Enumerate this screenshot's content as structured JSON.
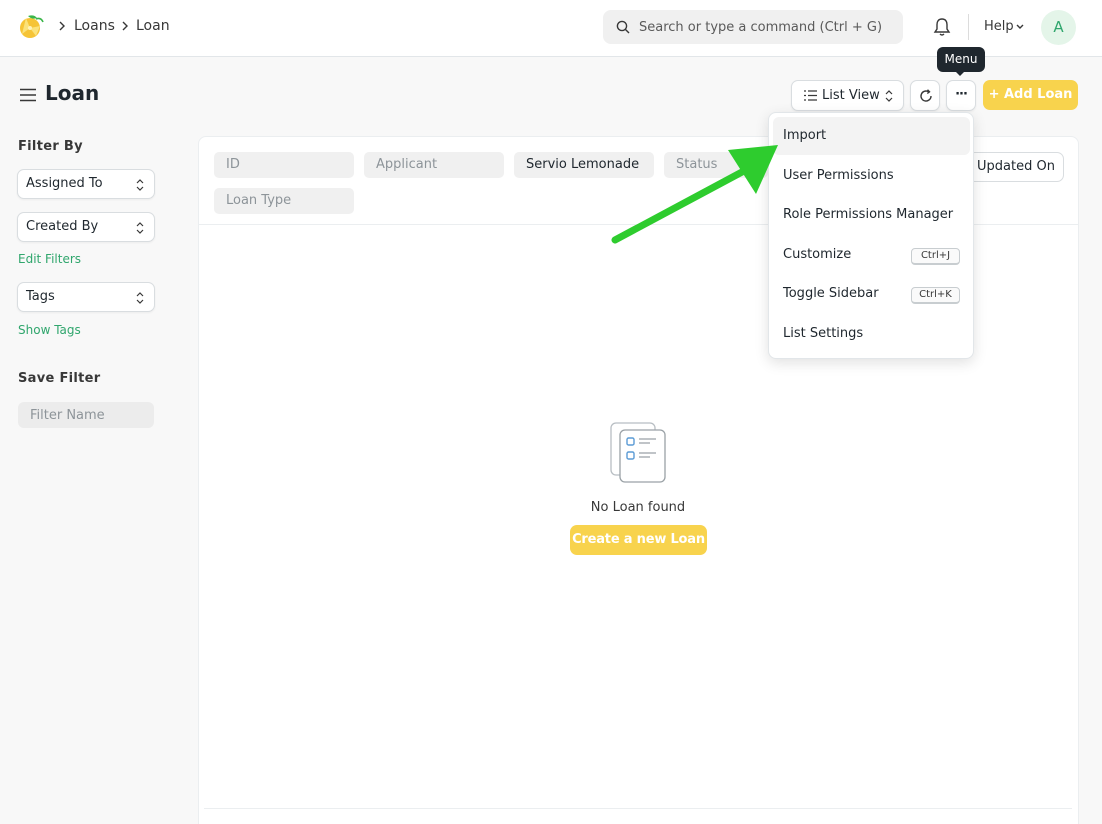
{
  "navbar": {
    "breadcrumbs": [
      "Loans",
      "Loan"
    ],
    "search_placeholder": "Search or type a command (Ctrl + G)",
    "help_label": "Help",
    "avatar_initial": "A"
  },
  "page": {
    "title": "Loan",
    "list_view_label": "List View",
    "add_button_label": "+ Add Loan",
    "menu_tooltip": "Menu"
  },
  "sidebar": {
    "filter_by_heading": "Filter By",
    "assigned_to": "Assigned To",
    "created_by": "Created By",
    "edit_filters": "Edit Filters",
    "tags": "Tags",
    "show_tags": "Show Tags",
    "save_filter_heading": "Save Filter",
    "filter_name_placeholder": "Filter Name"
  },
  "filters": {
    "id_placeholder": "ID",
    "applicant_placeholder": "Applicant",
    "company_value": "Servio Lemonade",
    "status_placeholder": "Status",
    "loan_type_placeholder": "Loan Type",
    "sort_label": "Updated On"
  },
  "empty_state": {
    "message": "No Loan found",
    "create_button": "Create a new Loan"
  },
  "dropdown_menu": {
    "items": [
      {
        "label": "Import"
      },
      {
        "label": "User Permissions"
      },
      {
        "label": "Role Permissions Manager"
      },
      {
        "label": "Customize",
        "shortcut": "Ctrl+J"
      },
      {
        "label": "Toggle Sidebar",
        "shortcut": "Ctrl+K"
      },
      {
        "label": "List Settings"
      }
    ]
  },
  "colors": {
    "primary_yellow": "#f8d34d",
    "link_green": "#30a66d",
    "annotation_arrow": "#2ecc2e"
  }
}
